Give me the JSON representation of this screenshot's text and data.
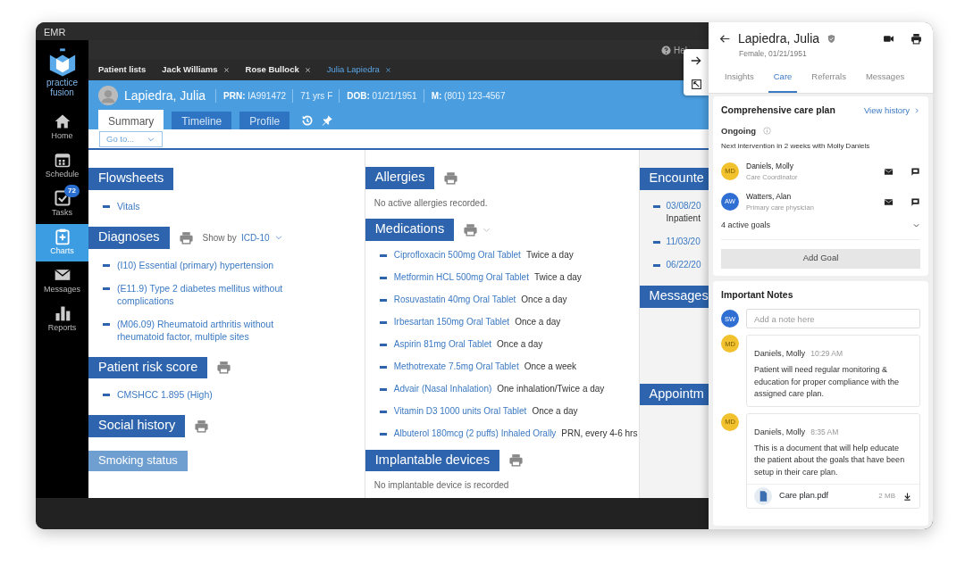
{
  "window": {
    "title": "EMR"
  },
  "sidebar": {
    "logo_text": "practice fusion",
    "items": [
      {
        "label": "Home",
        "selected": false
      },
      {
        "label": "Schedule",
        "selected": false
      },
      {
        "label": "Tasks",
        "badge": "72",
        "selected": false
      },
      {
        "label": "Charts",
        "selected": true
      },
      {
        "label": "Messages",
        "selected": false
      },
      {
        "label": "Reports",
        "selected": false
      }
    ]
  },
  "top_bar": {
    "help": "Hel"
  },
  "patient_tabs": [
    {
      "label": "Patient lists",
      "closable": false,
      "selected": false
    },
    {
      "label": "Jack Williams",
      "closable": true,
      "selected": false
    },
    {
      "label": "Rose Bullock",
      "closable": true,
      "selected": false
    },
    {
      "label": "Julia Lapiedra",
      "closable": true,
      "selected": true
    }
  ],
  "patient_header": {
    "name": "Lapiedra, Julia",
    "fields": [
      {
        "label": "PRN:",
        "value": "IA991472"
      },
      {
        "value": "71 yrs F"
      },
      {
        "label": "DOB:",
        "value": "01/21/1951"
      },
      {
        "label": "M:",
        "value": "(801) 123-4567"
      }
    ]
  },
  "view_tabs": [
    {
      "label": "Summary",
      "selected": true
    },
    {
      "label": "Timeline",
      "selected": false
    },
    {
      "label": "Profile",
      "selected": false
    }
  ],
  "goto": {
    "value": "Go to..."
  },
  "columns": [
    [
      {
        "title": "Flowsheets",
        "printable": false,
        "items": [
          {
            "link": "Vitals"
          }
        ]
      },
      {
        "title": "Diagnoses",
        "printable": true,
        "show_by": {
          "label": "Show by",
          "value": "ICD-10"
        },
        "items": [
          {
            "link": "(I10) Essential (primary) hypertension"
          },
          {
            "link": "(E11.9) Type 2 diabetes mellitus without complications"
          },
          {
            "link": "(M06.09) Rheumatoid arthritis without rheumatoid factor, multiple sites"
          }
        ]
      },
      {
        "title": "Patient risk score",
        "printable": true,
        "items": [
          {
            "link": "CMSHCC 1.895 (High)"
          }
        ]
      },
      {
        "title": "Social history",
        "printable": true,
        "subheading": "Smoking status"
      }
    ],
    [
      {
        "title": "Allergies",
        "printable": true,
        "empty": "No active allergies recorded."
      },
      {
        "title": "Medications",
        "printable": true,
        "has_menu": true,
        "items": [
          {
            "link": "Ciprofloxacin 500mg Oral Tablet",
            "note": "Twice a day"
          },
          {
            "link": "Metformin HCL 500mg Oral Tablet",
            "note": "Twice a day"
          },
          {
            "link": "Rosuvastatin 40mg Oral Tablet",
            "note": "Once a day"
          },
          {
            "link": "Irbesartan 150mg Oral Tablet",
            "note": "Once a day"
          },
          {
            "link": "Aspirin 81mg Oral Tablet",
            "note": "Once a day"
          },
          {
            "link": "Methotrexate 7.5mg Oral Tablet",
            "note": "Once a week"
          },
          {
            "link": "Advair (Nasal Inhalation)",
            "note": "One inhalation/Twice a day"
          },
          {
            "link": "Vitamin D3 1000 units Oral Tablet",
            "note": "Once a day"
          },
          {
            "link": "Albuterol 180mcg (2 puffs) Inhaled Orally",
            "note": "PRN, every 4-6 hrs"
          }
        ]
      },
      {
        "title": "Implantable devices",
        "printable": true,
        "empty": "No implantable device is recorded"
      }
    ],
    [
      {
        "title": "Encounte",
        "printable": false,
        "items": [
          {
            "link": "03/08/20",
            "note": "Inpatient"
          },
          {
            "link": "11/03/20"
          },
          {
            "link": "06/22/20"
          }
        ]
      },
      {
        "title": "Messages",
        "printable": false
      },
      {
        "title": "Appointm",
        "printable": false
      }
    ]
  ],
  "care_panel": {
    "name": "Lapiedra, Julia",
    "verified": true,
    "subtitle": "Female, 01/21/1951",
    "tabs": [
      {
        "label": "Insights",
        "selected": false
      },
      {
        "label": "Care",
        "selected": true
      },
      {
        "label": "Referrals",
        "selected": false
      },
      {
        "label": "Messages",
        "selected": false
      }
    ],
    "care_plan": {
      "title": "Comprehensive care plan",
      "link": "View history",
      "status": "Ongoing",
      "next": "Next intervention in 2 weeks with Molly Daniels",
      "team": [
        {
          "initials": "MD",
          "name": "Daniels, Molly",
          "role": "Care Coordinator",
          "color": "#f2c12e"
        },
        {
          "initials": "AW",
          "name": "Watters, Alan",
          "role": "Primary care physician",
          "color": "#2f6fd3"
        }
      ],
      "goals": "4 active goals",
      "goals_expanded": false,
      "add_button": "Add Goal"
    },
    "notes": {
      "title": "Important Notes",
      "author": {
        "initials": "SW",
        "color": "#2f6fd3"
      },
      "placeholder": "Add a note here",
      "items": [
        {
          "initials": "MD",
          "color": "#f2c12e",
          "author": "Daniels, Molly",
          "time": "10:29 AM",
          "text": "Patient will need regular monitoring & education for proper compliance with the assigned care plan."
        },
        {
          "initials": "MD",
          "color": "#f2c12e",
          "author": "Daniels, Molly",
          "time": "8:35 AM",
          "text": "This is a document that will help educate the patient about the goals that have been setup in their care plan.",
          "attachment": {
            "name": "Care plan.pdf",
            "size": "2 MB"
          }
        }
      ]
    }
  }
}
